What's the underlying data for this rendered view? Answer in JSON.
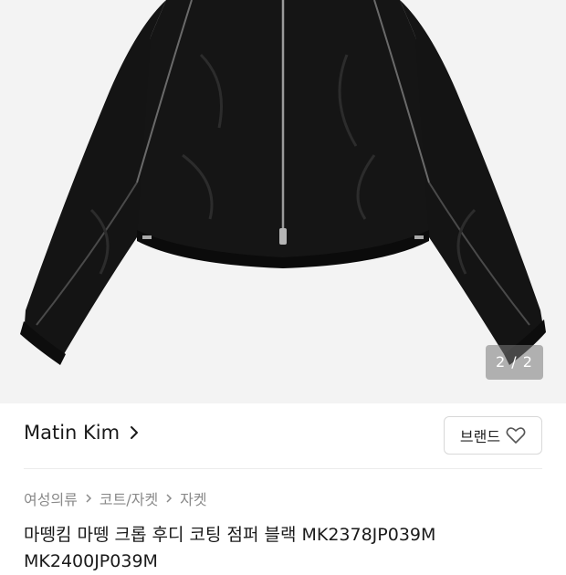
{
  "image": {
    "counter": "2 / 2"
  },
  "brand": {
    "name": "Matin Kim",
    "button_label": "브랜드"
  },
  "breadcrumb": {
    "items": [
      "여성의류",
      "코트/자켓",
      "자켓"
    ]
  },
  "product": {
    "title": "마뗑킴 마뗑 크롭 후디 코팅 점퍼 블랙 MK2378JP039M MK2400JP039M"
  }
}
